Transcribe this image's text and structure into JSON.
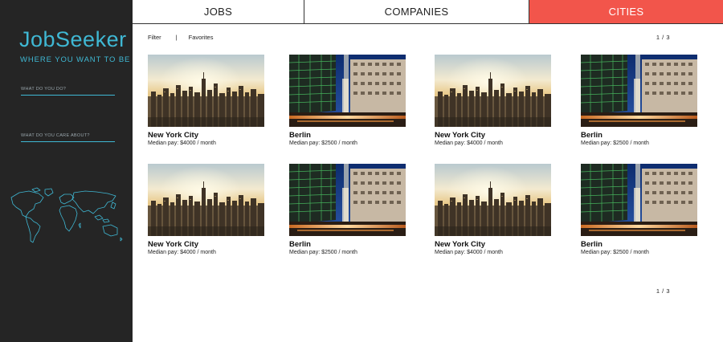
{
  "sidebar": {
    "logo": "JobSeeker",
    "tagline": "WHERE YOU WANT TO BE",
    "field_do_placeholder": "WHAT DO YOU DO?",
    "field_care_placeholder": "WHAT DO YOU CARE ABOUT?",
    "accent_color": "#3fb8d4",
    "map_icon": "world-map-icon"
  },
  "nav": {
    "tabs": [
      {
        "label": "JOBS",
        "active": false
      },
      {
        "label": "COMPANIES",
        "active": false
      },
      {
        "label": "CITIES",
        "active": true
      }
    ],
    "active_color": "#f2554b"
  },
  "toolbar": {
    "filter": "Filter",
    "separator": "|",
    "favorites": "Favorites"
  },
  "pagination": {
    "top": "1 / 3",
    "bottom": "1 / 3"
  },
  "cities": [
    {
      "name": "New York City",
      "pay": "Median pay: $4000 / month",
      "image": "new-york-skyline"
    },
    {
      "name": "Berlin",
      "pay": "Median pay: $2500 / month",
      "image": "berlin-night"
    },
    {
      "name": "New York City",
      "pay": "Median pay: $4000 / month",
      "image": "new-york-skyline"
    },
    {
      "name": "Berlin",
      "pay": "Median pay: $2500 / month",
      "image": "berlin-night"
    },
    {
      "name": "New York City",
      "pay": "Median pay: $4000 / month",
      "image": "new-york-skyline"
    },
    {
      "name": "Berlin",
      "pay": "Median pay: $2500 / month",
      "image": "berlin-night"
    },
    {
      "name": "New York City",
      "pay": "Median pay: $4000 / month",
      "image": "new-york-skyline"
    },
    {
      "name": "Berlin",
      "pay": "Median pay: $2500 / month",
      "image": "berlin-night"
    }
  ]
}
